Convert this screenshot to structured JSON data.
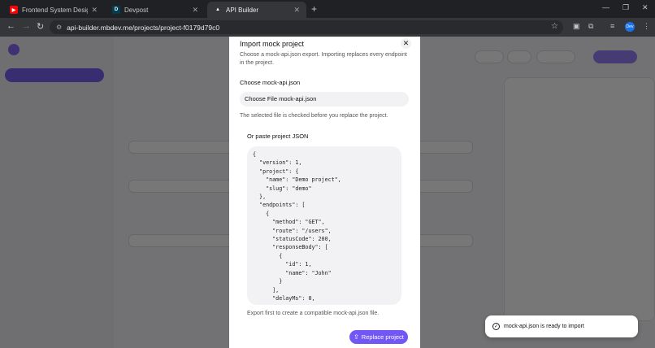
{
  "browser": {
    "tabs": [
      {
        "title": "Frontend System Design Explai",
        "icon": "youtube-icon",
        "icon_color": "#ff0000"
      },
      {
        "title": "Devpost",
        "icon": "devpost-icon",
        "icon_color": "#003e54"
      },
      {
        "title": "API Builder",
        "icon": "api-builder-icon",
        "icon_color": "#ffffff"
      }
    ],
    "url": "api-builder.mbdev.me/projects/project-f0179d79c0",
    "profile_initial": "Dev"
  },
  "modal": {
    "title": "Import mock project",
    "description": "Choose a mock-api.json export. Importing replaces every endpoint in the project.",
    "choose_label": "Choose mock-api.json",
    "file_button": "Choose File mock-api.json",
    "help_text": "The selected file is checked before you replace the project.",
    "paste_label": "Or paste project JSON",
    "json_text": "{\n  \"version\": 1,\n  \"project\": {\n    \"name\": \"Demo project\",\n    \"slug\": \"demo\"\n  },\n  \"endpoints\": [\n    {\n      \"method\": \"GET\",\n      \"route\": \"/users\",\n      \"statusCode\": 200,\n      \"responseBody\": [\n        {\n          \"id\": 1,\n          \"name\": \"John\"\n        }\n      ],\n      \"delayMs\": 0,",
    "footer_text": "Export first to create a compatible mock-api.json file.",
    "submit_label": "Replace project"
  },
  "toast": {
    "message": "mock-api.json is ready to import"
  },
  "colors": {
    "accent": "#7357f6",
    "backdrop": "rgba(20,20,22,0.58)"
  }
}
